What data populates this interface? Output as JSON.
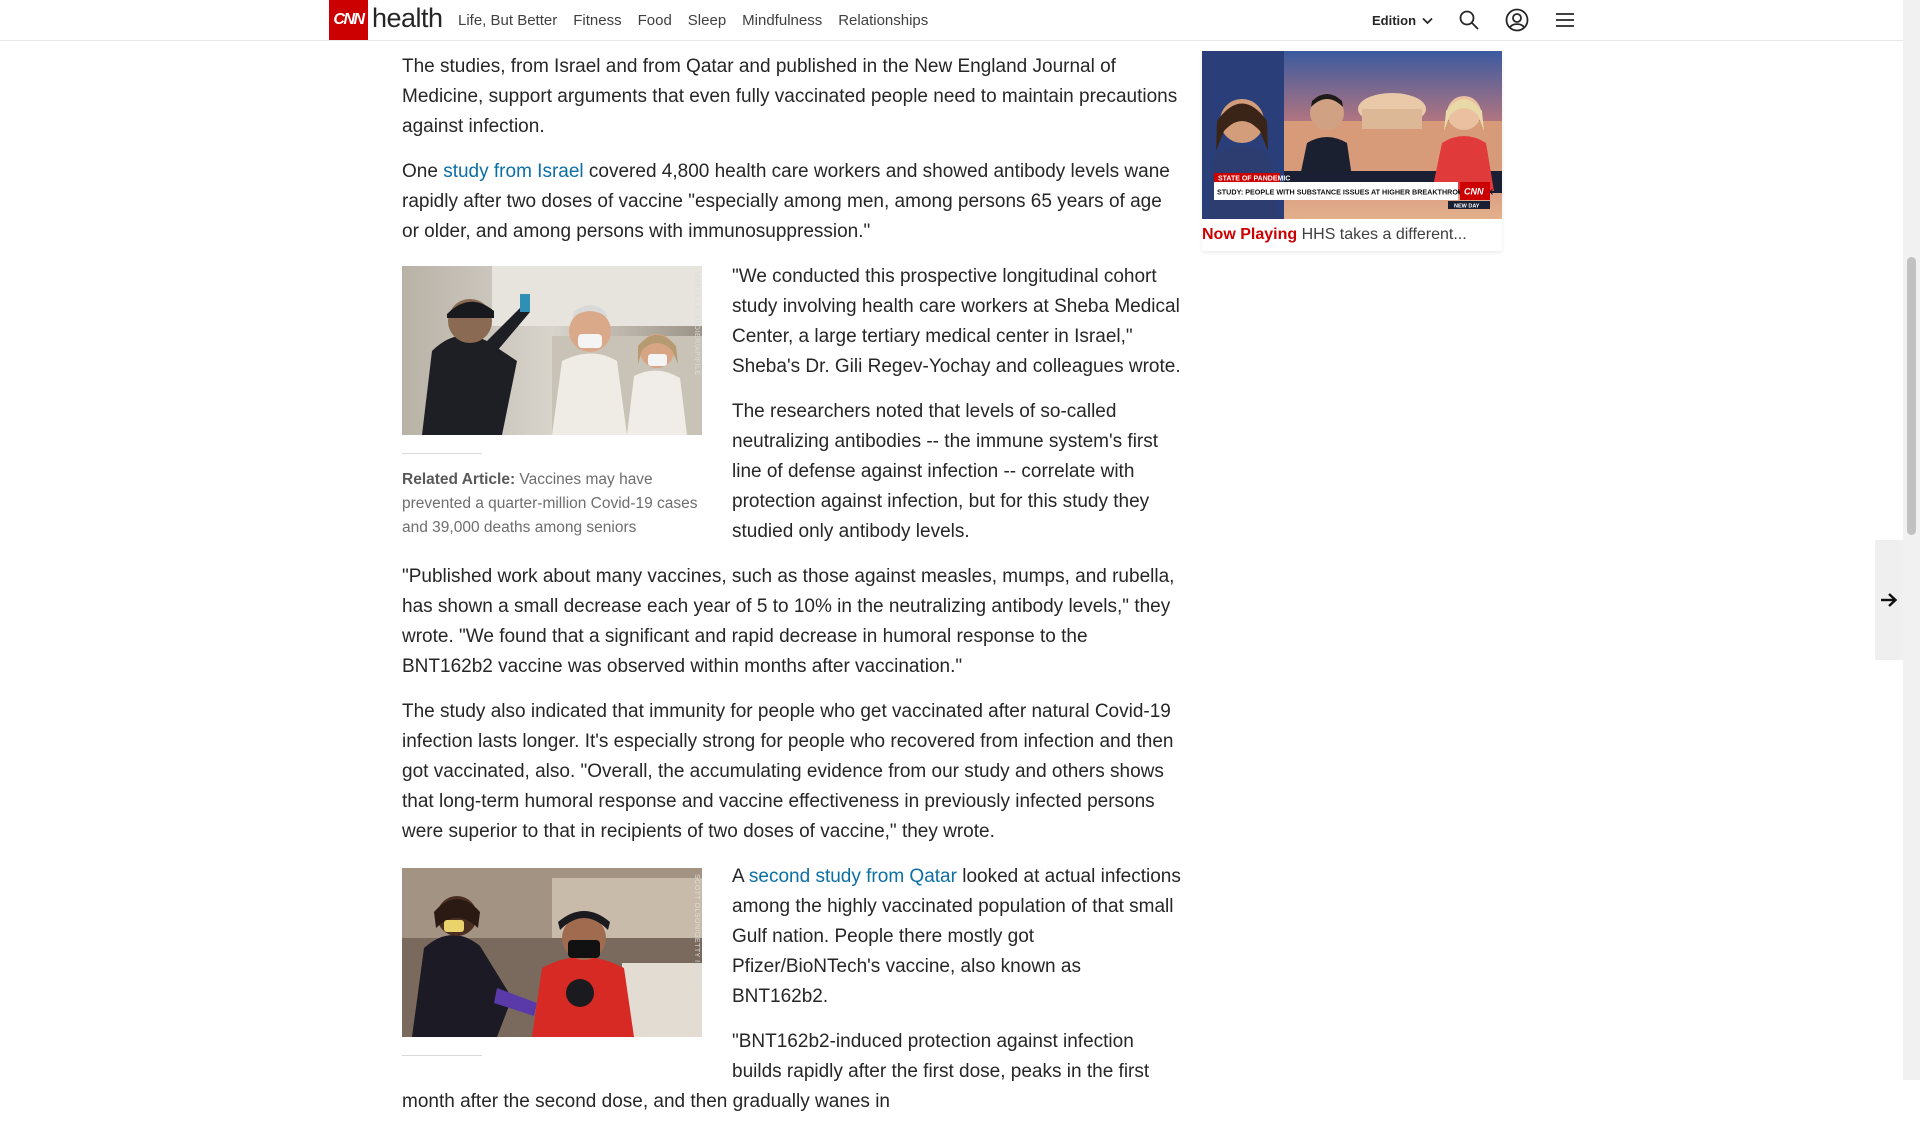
{
  "header": {
    "logo_text": "CNN",
    "section": "health",
    "nav": [
      "Life, But Better",
      "Fitness",
      "Food",
      "Sleep",
      "Mindfulness",
      "Relationships"
    ],
    "edition_label": "Edition",
    "icons": [
      "chevron-down-icon",
      "search-icon",
      "user-account-icon",
      "hamburger-menu-icon"
    ]
  },
  "article": {
    "p1": "The studies, from Israel and from Qatar and published in the New England Journal of Medicine, support arguments that even fully vaccinated people need to maintain precautions against infection.",
    "p2": {
      "before": "One ",
      "link": "study from Israel",
      "after": " covered 4,800 health care workers and showed antibody levels wane rapidly after two doses of vaccine \"especially among men, among persons 65 years of age or older, and among persons with immunosuppression.\""
    },
    "figure1": {
      "credit": "MARTA LAVANDIER/AP/FILE",
      "related_label": "Related Article:",
      "related_text": " Vaccines may have prevented a quarter-million Covid-19 cases and 39,000 deaths among seniors"
    },
    "p3": "\"We conducted this prospective longitudinal cohort study involving health care workers at Sheba Medical Center, a large tertiary medical center in Israel,\" Sheba's Dr. Gili Regev-Yochay and colleagues wrote.",
    "p4": "The researchers noted that levels of so-called neutralizing antibodies -- the immune system's first line of defense against infection -- correlate with protection against infection, but for this study they studied only antibody levels.",
    "p5": "\"Published work about many vaccines, such as those against measles, mumps, and rubella, has shown a small decrease each year of 5 to 10% in the neutralizing antibody levels,\" they wrote. \"We found that a significant and rapid decrease in humoral response to the BNT162b2 vaccine was observed within months after vaccination.\"",
    "p6": "The study also indicated that immunity for people who get vaccinated after natural Covid-19 infection lasts longer. It's especially strong for people who recovered from infection and then got vaccinated, also. \"Overall, the accumulating evidence from our study and others shows that long-term humoral response and vaccine effectiveness in previously infected persons were superior to that in recipients of two doses of vaccine,\" they wrote.",
    "figure2": {
      "credit": "SCOTT OLSON/GETTY IMAGES"
    },
    "p7": {
      "before": "A ",
      "link": "second study from Qatar",
      "after": " looked at actual infections among the highly vaccinated population of that small Gulf nation. People there mostly got Pfizer/BioNTech's vaccine, also known as BNT162b2."
    },
    "p8": "\"BNT162b2-induced protection against infection builds rapidly after the first dose, peaks in the first month after the second dose, and then gradually wanes in"
  },
  "sidebar": {
    "video": {
      "banner_tag": "STATE OF PANDEMIC",
      "banner_headline": "STUDY: PEOPLE WITH SUBSTANCE ISSUES AT HIGHER BREAKTHROUGH RISK",
      "network_logo": "CNN",
      "show": "NEW DAY",
      "now_playing_label": "Now Playing",
      "now_playing_title": "HHS takes a different..."
    }
  },
  "side_arrow_icon": "arrow-right-icon"
}
